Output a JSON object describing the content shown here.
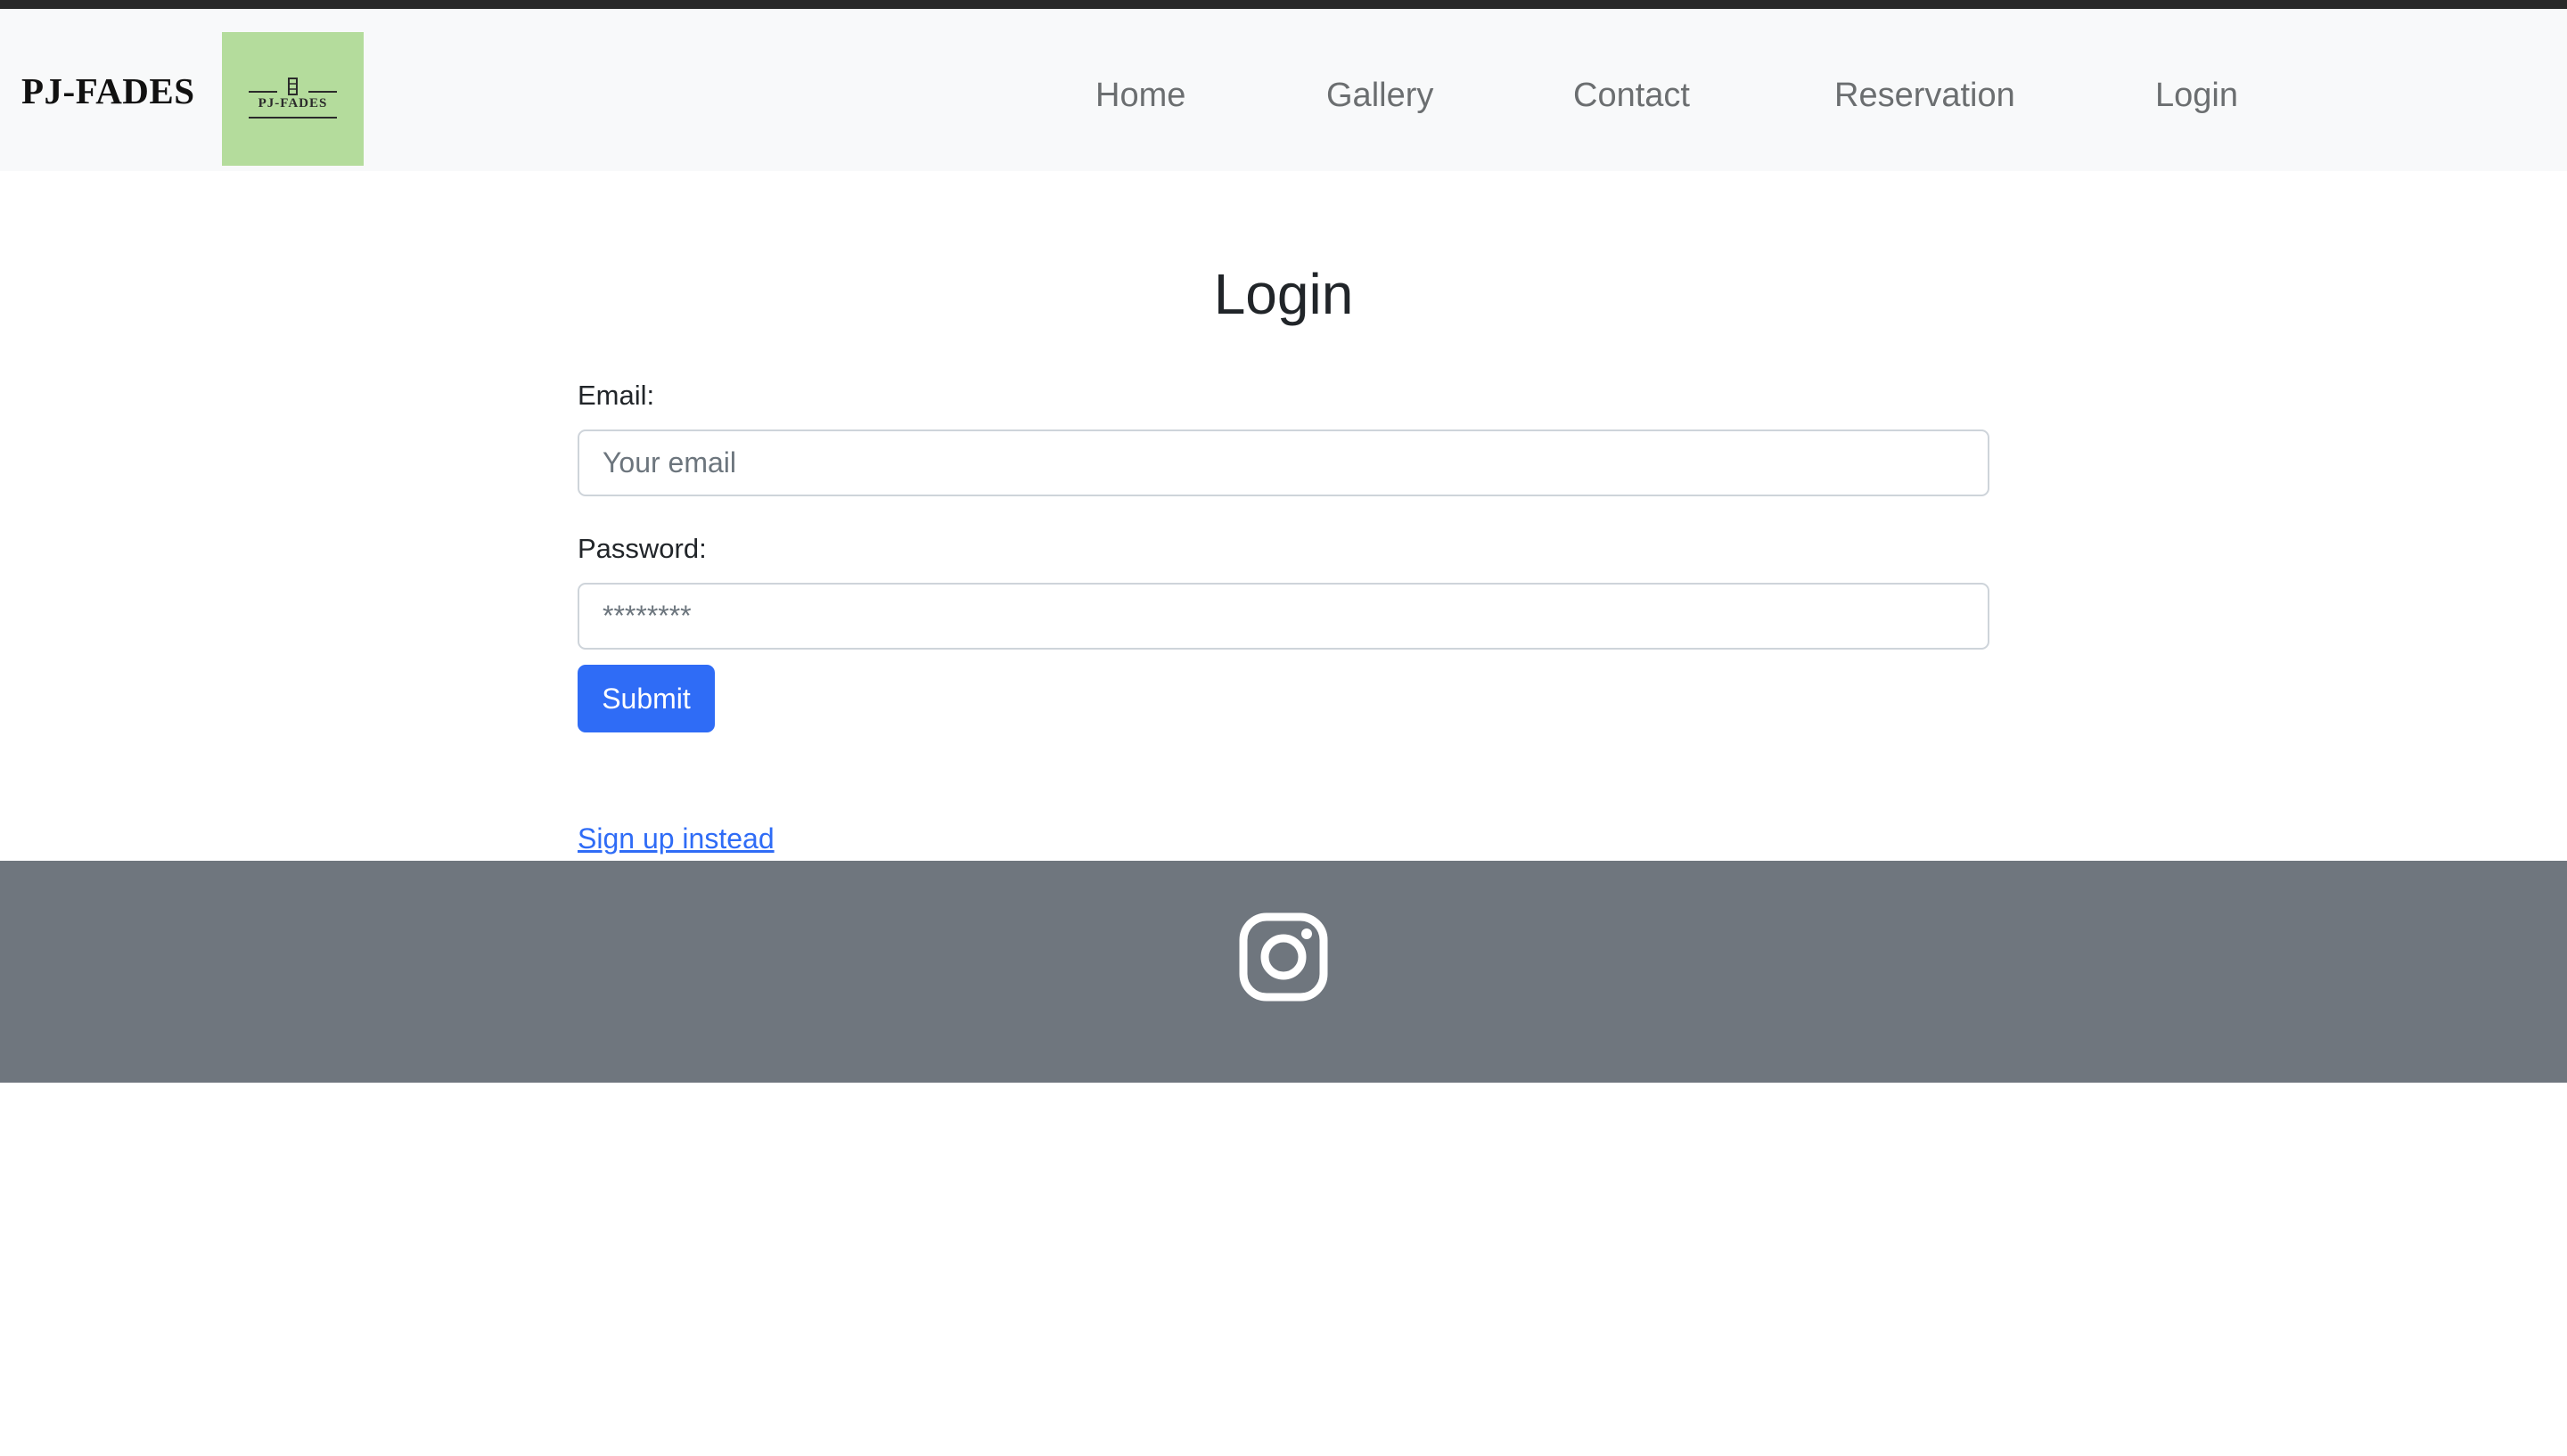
{
  "nav": {
    "brand": "PJ-FADES",
    "logo_text": "PJ-FADES",
    "links": [
      "Home",
      "Gallery",
      "Contact",
      "Reservation",
      "Login"
    ]
  },
  "login": {
    "title": "Login",
    "email_label": "Email:",
    "email_placeholder": "Your email",
    "password_label": "Password:",
    "password_placeholder": "********",
    "submit_label": "Submit",
    "signup_text": "Sign up instead"
  },
  "footer": {
    "icon": "instagram-icon"
  },
  "colors": {
    "primary": "#2f6cf6",
    "navbar_bg": "#f8f9fa",
    "footer_bg": "#6f767e",
    "logo_bg": "#b4dc9c"
  }
}
